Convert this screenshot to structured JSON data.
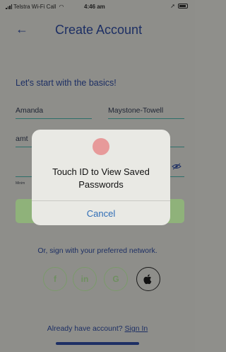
{
  "status_bar": {
    "carrier": "Telstra Wi-Fi Call",
    "time": "4:46 am"
  },
  "header": {
    "title": "Create Account"
  },
  "form": {
    "heading": "Let's start with the basics!",
    "first_name": "Amanda",
    "last_name": "Maystone-Towell",
    "email_partial": "amt",
    "password_hint": "Minim"
  },
  "social": {
    "prompt": "Or, sign with your preferred network.",
    "facebook_glyph": "f",
    "linkedin_glyph": "in",
    "google_glyph": "G",
    "apple_glyph": ""
  },
  "footer": {
    "text": "Already have account?",
    "link": "Sign In"
  },
  "alert": {
    "title": "Touch ID to View Saved Passwords",
    "cancel_label": "Cancel"
  },
  "colors": {
    "accent": "#1d2f64",
    "button_green": "#8fb27a",
    "alert_link": "#2f6db5"
  }
}
